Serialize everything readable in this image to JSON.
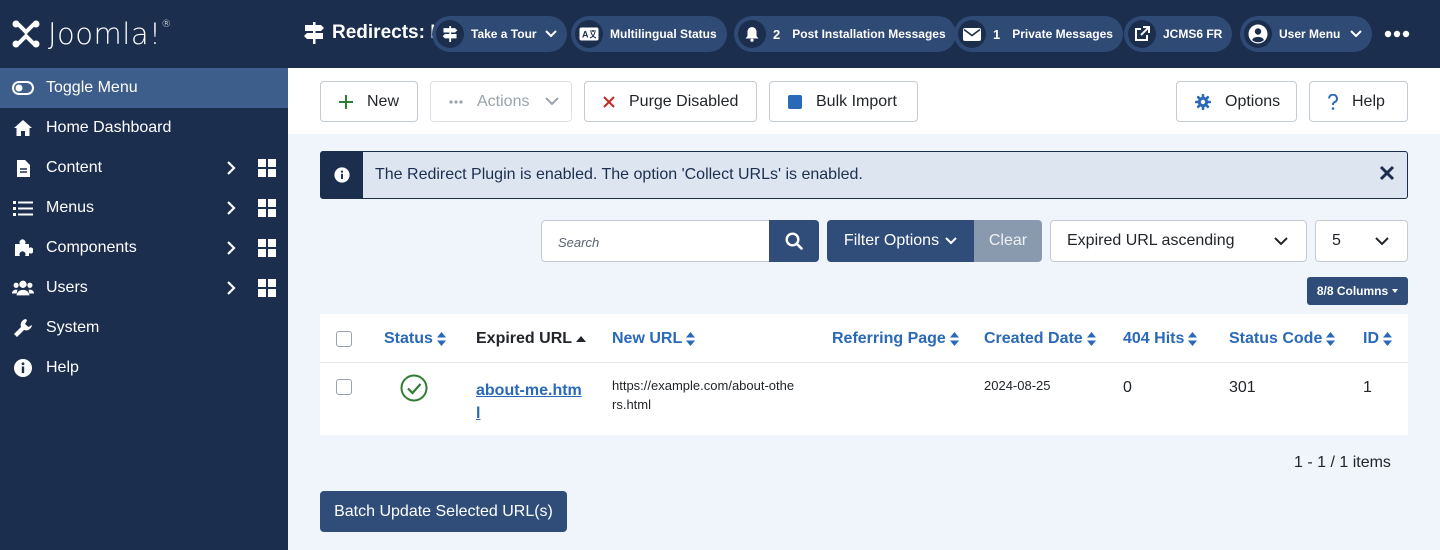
{
  "sidebar": {
    "brand": "Joomla!",
    "items": [
      {
        "label": "Toggle Menu",
        "icon": "toggle-icon"
      },
      {
        "label": "Home Dashboard",
        "icon": "home-icon"
      },
      {
        "label": "Content",
        "icon": "file-icon"
      },
      {
        "label": "Menus",
        "icon": "list-icon"
      },
      {
        "label": "Components",
        "icon": "puzzle-icon"
      },
      {
        "label": "Users",
        "icon": "users-icon"
      },
      {
        "label": "System",
        "icon": "wrench-icon"
      },
      {
        "label": "Help",
        "icon": "info-icon"
      }
    ]
  },
  "header": {
    "title": "Redirects: Links",
    "take_tour": "Take a Tour",
    "multilingual": "Multilingual Status",
    "post_install_count": "2",
    "post_install": "Post Installation Messages",
    "private_count": "1",
    "private_messages": "Private Messages",
    "site": "JCMS6 FR",
    "user_menu": "User Menu"
  },
  "toolbar": {
    "new": "New",
    "actions": "Actions",
    "purge": "Purge Disabled",
    "bulk": "Bulk Import",
    "options": "Options",
    "help": "Help"
  },
  "alert": {
    "message": "The Redirect Plugin is enabled. The option 'Collect URLs' is enabled."
  },
  "filters": {
    "search_placeholder": "Search",
    "filter_options": "Filter Options",
    "clear": "Clear",
    "ordering": "Expired URL ascending",
    "limit": "5",
    "columns": "8/8 Columns"
  },
  "table": {
    "headers": [
      "Status",
      "Expired URL",
      "New URL",
      "Referring Page",
      "Created Date",
      "404 Hits",
      "Status Code",
      "ID"
    ],
    "rows": [
      {
        "expired_l1": "about-me.htm",
        "expired_l2": "l",
        "new_l1": "https://example.com/about-othe",
        "new_l2": "rs.html",
        "referring": "",
        "created": "2024-08-25",
        "hits": "0",
        "code": "301",
        "id": "1"
      }
    ]
  },
  "pagination": "1 - 1 / 1 items",
  "batch_button": "Batch Update Selected URL(s)",
  "colors": {
    "sidebar": "#1b2e4e",
    "active": "#3d5d8a",
    "primary": "#2f4d78",
    "link": "#2a69b8",
    "published": "#2f7d32"
  }
}
